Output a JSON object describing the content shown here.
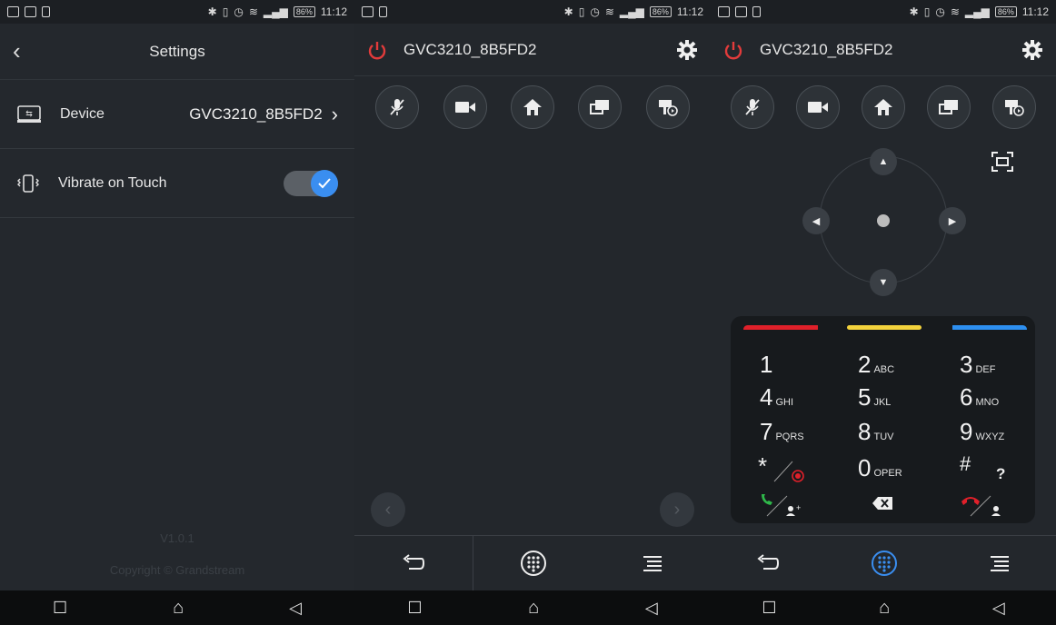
{
  "status_bar": {
    "time": "11:12",
    "battery": "86%"
  },
  "settings": {
    "title": "Settings",
    "device_label": "Device",
    "device_value": "GVC3210_8B5FD2",
    "vibrate_label": "Vibrate on Touch",
    "vibrate_on": true,
    "version_text": "V1.0.1",
    "copyright_text": "Copyright © Grandstream"
  },
  "remote": {
    "device_name": "GVC3210_8B5FD2",
    "top_buttons": [
      "mute-mic-icon",
      "camera-icon",
      "home-icon",
      "presentation-icon",
      "video-record-icon"
    ],
    "fullscreen_icon": "fullscreen-icon"
  },
  "keypad": {
    "color_keys": [
      "#e0202a",
      "#f3d23c",
      "#2d8ff0"
    ],
    "keys": [
      {
        "digit": "1",
        "letters": ""
      },
      {
        "digit": "2",
        "letters": "ABC"
      },
      {
        "digit": "3",
        "letters": "DEF"
      },
      {
        "digit": "4",
        "letters": "GHI"
      },
      {
        "digit": "5",
        "letters": "JKL"
      },
      {
        "digit": "6",
        "letters": "MNO"
      },
      {
        "digit": "7",
        "letters": "PQRS"
      },
      {
        "digit": "8",
        "letters": "TUV"
      },
      {
        "digit": "9",
        "letters": "WXYZ"
      },
      {
        "digit": "*",
        "letters": ""
      },
      {
        "digit": "0",
        "letters": "OPER"
      },
      {
        "digit": "#",
        "letters": "?"
      }
    ]
  },
  "colors": {
    "accent": "#3a8ef0",
    "power": "#e23b3b"
  }
}
